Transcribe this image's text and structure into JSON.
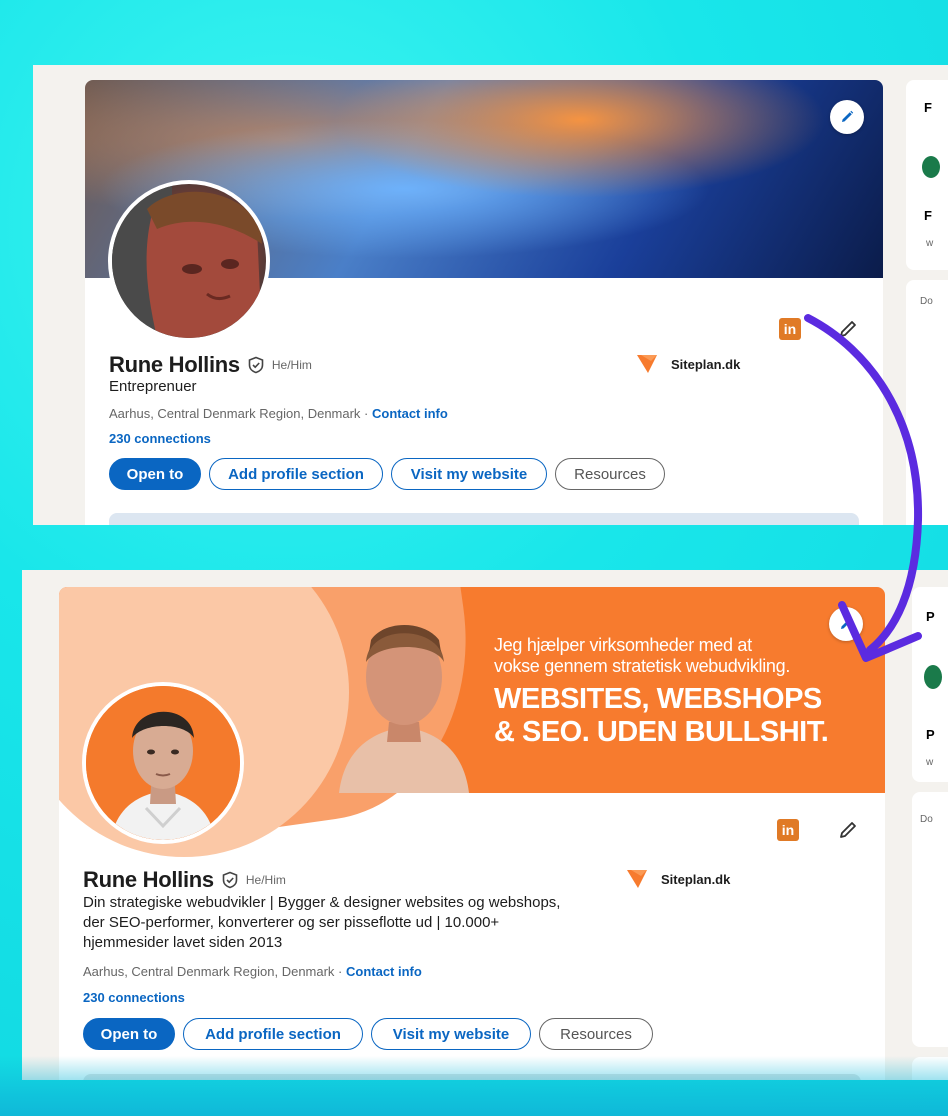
{
  "before": {
    "name": "Rune Hollins",
    "pronouns": "He/Him",
    "headline": "Entreprenuer",
    "location": "Aarhus, Central Denmark Region, Denmark · ",
    "contact_info": "Contact info",
    "connections": "230 connections",
    "company": "Siteplan.dk",
    "buttons": {
      "open_to": "Open to",
      "add_section": "Add profile section",
      "visit_website": "Visit my website",
      "resources": "Resources"
    },
    "linkedin_badge": "in",
    "sidebar": {
      "letter1": "F",
      "letter2": "F",
      "small1": "w",
      "small2": "Do"
    }
  },
  "after": {
    "name": "Rune Hollins",
    "pronouns": "He/Him",
    "headline": "Din strategiske webudvikler | Bygger & designer websites og webshops, der SEO-performer, konverterer og ser pisseflotte ud | 10.000+ hjemmesider lavet siden 2013",
    "location": "Aarhus, Central Denmark Region, Denmark · ",
    "contact_info": "Contact info",
    "connections": "230 connections",
    "company": "Siteplan.dk",
    "buttons": {
      "open_to": "Open to",
      "add_section": "Add profile section",
      "visit_website": "Visit my website",
      "resources": "Resources"
    },
    "linkedin_badge": "in",
    "banner": {
      "line1": "Jeg hjælper virksomheder med at",
      "line2": "vokse gennem stratetisk webudvikling.",
      "line3": "WEBSITES, WEBSHOPS",
      "line4": "& SEO. UDEN BULLSHIT."
    },
    "sidebar": {
      "letter1": "P",
      "letter2": "P",
      "small1": "w",
      "small2": "Do"
    }
  },
  "colors": {
    "background": "#1ce6ea",
    "linkedin_blue": "#0a66c2",
    "banner_orange": "#f77b2e",
    "arrow_purple": "#5b2be0"
  },
  "icons": [
    "verified-shield-icon",
    "pencil-icon",
    "linkedin-icon",
    "siteplan-logo-icon",
    "curved-arrow-icon"
  ]
}
